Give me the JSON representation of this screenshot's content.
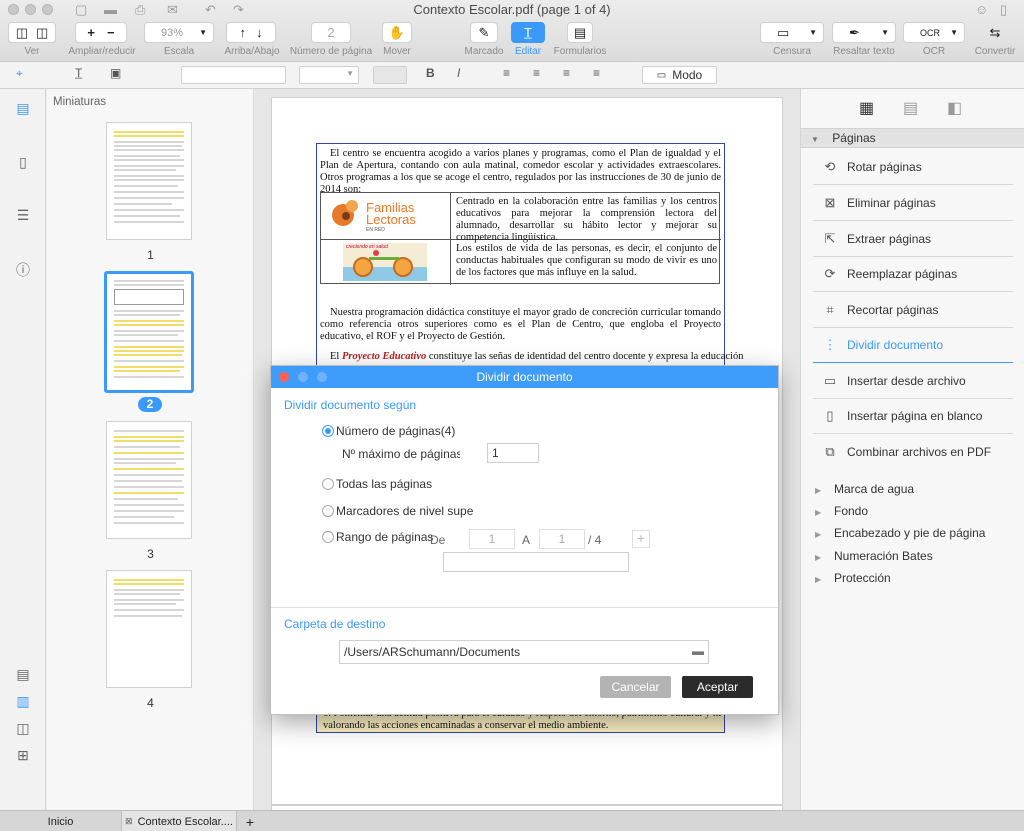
{
  "window": {
    "title": "Contexto Escolar.pdf (page 1 of 4)"
  },
  "toolbar": {
    "ver": "Ver",
    "ampliar": "Ampliar/reducir",
    "zoom_value": "93%",
    "escala": "Escala",
    "arriba_abajo": "Arriba/Abajo",
    "page_number_value": "2",
    "numero_pagina": "Número de página",
    "mover": "Mover",
    "marcado": "Marcado",
    "editar": "Editar",
    "formularios": "Formularios",
    "censura": "Censura",
    "resaltar": "Resaltar texto",
    "ocr": "OCR",
    "convertir": "Convertir"
  },
  "formatbar": {
    "modo": "Modo",
    "bold": "B",
    "italic": "I"
  },
  "thumbnails": {
    "title": "Miniaturas",
    "pages": [
      "1",
      "2",
      "3",
      "4"
    ],
    "selected": "2"
  },
  "document": {
    "para1": "El centro se encuentra acogido a varios planes y programas, como el Plan de igualdad y el Plan de Apertura, contando con aula matinal, comedor escolar y actividades extraescolares. Otros programas a los que se acoge el centro, regulados por las instrucciones de 30 de junio de 2014 son:",
    "logo1_main": "Familias",
    "logo1_sub": "Lectoras",
    "logo1_tag": "EN RED",
    "logo2_tag": "creciendo en salud",
    "cell1": "Centrado en la colaboración entre las familias y los centros educativos para mejorar la comprensión lectora del alumnado, desarrollar su hábito lector y mejorar su competencia lingüística.",
    "cell2": "Los estilos de vida de las personas, es decir, el conjunto de conductas habituales que configuran su modo de vivir es uno de los factores que más influye en la salud.",
    "para2": "Nuestra programación didáctica constituye el mayor grado de concreción curricular tomando como referencia otros superiores como es el Plan de Centro, que engloba el Proyecto educativo, el ROF y el Proyecto de Gestión.",
    "para3_prefix": "El",
    "para3_emph": "Proyecto Educativo",
    "para3_rest": "constituye las señas de identidad del centro docente y expresa la educación",
    "bottom_line1": "6. Fomentar una actitud positiva para el cuidado y respeto del entorno, patrimonio cultural y natural,",
    "bottom_line2": "valorando las acciones encaminadas a conservar el medio ambiente."
  },
  "right_panel": {
    "section": "Páginas",
    "items": [
      {
        "label": "Rotar páginas",
        "icon": "rotate-icon"
      },
      {
        "label": "Eliminar páginas",
        "icon": "delete-page-icon"
      },
      {
        "label": "Extraer páginas",
        "icon": "extract-icon"
      },
      {
        "label": "Reemplazar páginas",
        "icon": "replace-icon"
      },
      {
        "label": "Recortar páginas",
        "icon": "crop-icon"
      },
      {
        "label": "Dividir documento",
        "icon": "split-icon"
      },
      {
        "label": "Insertar desde archivo",
        "icon": "insert-file-icon"
      },
      {
        "label": "Insertar página en blanco",
        "icon": "blank-page-icon"
      },
      {
        "label": "Combinar archivos en PDF",
        "icon": "combine-icon"
      }
    ],
    "collapsed": [
      "Marca de agua",
      "Fondo",
      "Encabezado y pie de página",
      "Numeración Bates",
      "Protección"
    ]
  },
  "dialog": {
    "title": "Dividir documento",
    "section1": "Dividir documento según",
    "option_pages": "Número de páginas(4)",
    "max_pages_label": "Nº máximo de páginas",
    "max_pages_value": "1",
    "option_all": "Todas las páginas",
    "option_bookmarks": "Marcadores de nivel supe",
    "option_range": "Rango de páginas",
    "range_from_label": "De",
    "range_from": "1",
    "range_to_label": "A",
    "range_to": "1",
    "range_total": "/ 4",
    "section2": "Carpeta de destino",
    "folder_path": "/Users/ARSchumann/Documents",
    "cancel": "Cancelar",
    "accept": "Aceptar"
  },
  "tabs": {
    "home": "Inicio",
    "doc": "Contexto Escolar...."
  },
  "colors": {
    "accent": "#3b99fc",
    "dialog_title": "#3e9dfb"
  }
}
